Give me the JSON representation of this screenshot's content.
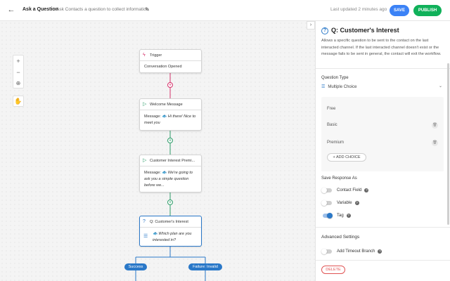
{
  "header": {
    "title": "Ask a Question",
    "subtitle": "Ask Contacts a question to collect information",
    "updated": "Last updated 2 minutes ago",
    "save_label": "SAVE",
    "publish_label": "PUBLISH",
    "back_icon": "arrow-left-icon",
    "edit_icon": "pencil-icon"
  },
  "canvas": {
    "zoom_in": "+",
    "zoom_out": "−",
    "nodes": {
      "trigger": {
        "title": "Trigger",
        "body": "Conversation Opened"
      },
      "welcome": {
        "title": "Welcome Message",
        "body_prefix": "Message:",
        "body": "🐟 Hi there! Nice to meet you"
      },
      "interest_msg": {
        "title": "Customer Interest Premi...",
        "body_prefix": "Message:",
        "body": "🐟 We're going to ask you a simple question before we..."
      },
      "question": {
        "title": "Q: Customer's Interest",
        "body": "🐟 Which plan are you interested in?"
      }
    },
    "branches": {
      "success": "Success",
      "failure": "Failure: Invalid"
    }
  },
  "panel": {
    "title": "Q: Customer's Interest",
    "description": "Allows a specific question to be sent to the contact on the last interacted channel. If the last interacted channel doesn't exist or the message fails to be sent in general, the contact will exit the workflow.",
    "question_type_label": "Question Type",
    "question_type_value": "Multiple Choice",
    "choices": [
      "Free",
      "Basic",
      "Premium"
    ],
    "add_choice_label": "+ ADD CHOICE",
    "save_response_label": "Save Response As",
    "save_options": [
      {
        "label": "Contact Field",
        "on": false
      },
      {
        "label": "Variable",
        "on": false
      },
      {
        "label": "Tag",
        "on": true
      }
    ],
    "advanced_label": "Advanced Settings",
    "timeout_label": "Add Timeout Branch",
    "timeout_on": false,
    "delete_label": "DELETE"
  },
  "colors": {
    "accent_blue": "#2a78c8",
    "save_blue": "#3b82f6",
    "publish_green": "#10b15a",
    "trigger_red": "#d6336c",
    "flow_green": "#2e9d6a",
    "delete_red": "#e05252"
  }
}
